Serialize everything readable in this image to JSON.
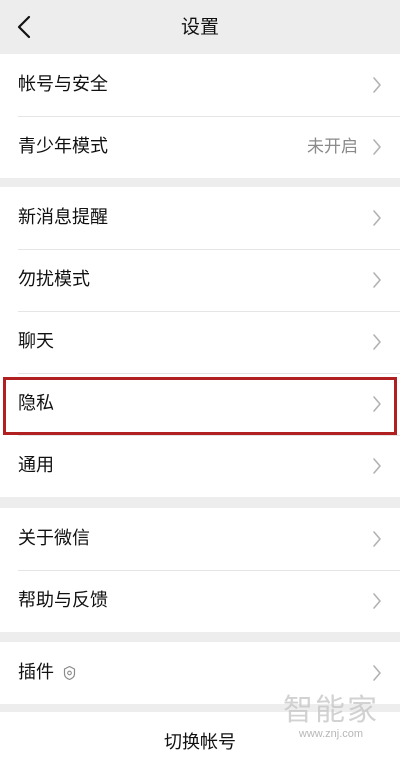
{
  "header": {
    "title": "设置",
    "back_icon": "chevron-left-icon"
  },
  "groups": [
    [
      {
        "label": "帐号与安全",
        "value": ""
      },
      {
        "label": "青少年模式",
        "value": "未开启"
      }
    ],
    [
      {
        "label": "新消息提醒",
        "value": ""
      },
      {
        "label": "勿扰模式",
        "value": ""
      },
      {
        "label": "聊天",
        "value": ""
      },
      {
        "label": "隐私",
        "value": ""
      },
      {
        "label": "通用",
        "value": ""
      }
    ],
    [
      {
        "label": "关于微信",
        "value": ""
      },
      {
        "label": "帮助与反馈",
        "value": ""
      }
    ],
    [
      {
        "label": "插件",
        "value": "",
        "icon": "plugin-badge-icon"
      }
    ]
  ],
  "footer": {
    "switch_account": "切换帐号"
  },
  "watermark": {
    "main": "智能家",
    "sub": "www.znj.com"
  },
  "colors": {
    "background": "#ededed",
    "card": "#ffffff",
    "highlight": "#b02020"
  }
}
